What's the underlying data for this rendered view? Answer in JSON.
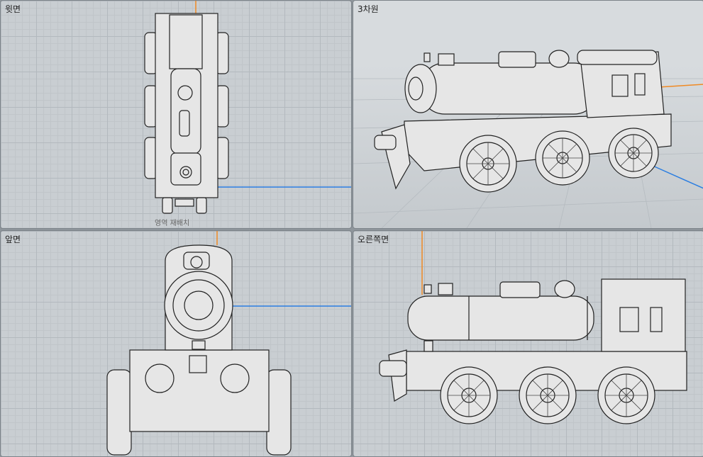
{
  "viewports": {
    "top": {
      "title": "윗면"
    },
    "perspective": {
      "title": "3차원"
    },
    "front": {
      "title": "앞면"
    },
    "right": {
      "title": "오른쪽면"
    }
  },
  "hints": {
    "rearrange": "영역 재배치"
  },
  "colors": {
    "x_axis": "#f08a24",
    "y_axis": "#2a7de1",
    "model_fill": "#e6e6e6",
    "model_stroke": "#222222"
  }
}
